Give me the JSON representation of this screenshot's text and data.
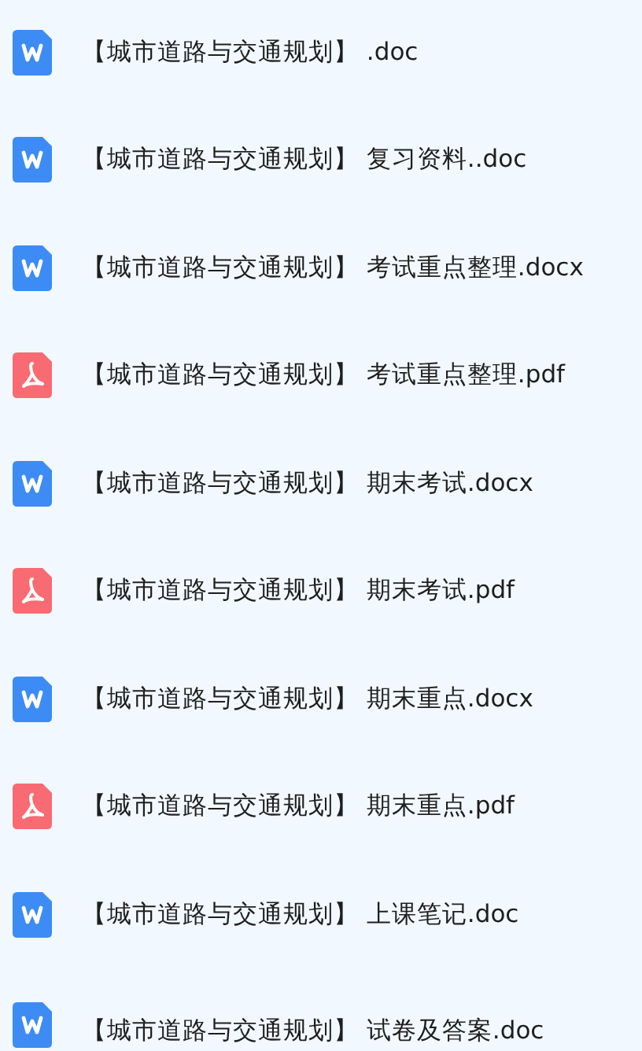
{
  "files": [
    {
      "kind": "doc",
      "name": "【城市道路与交通规划】 .doc"
    },
    {
      "kind": "doc",
      "name": "【城市道路与交通规划】 复习资料..doc"
    },
    {
      "kind": "doc",
      "name": "【城市道路与交通规划】 考试重点整理.docx"
    },
    {
      "kind": "pdf",
      "name": "【城市道路与交通规划】 考试重点整理.pdf"
    },
    {
      "kind": "doc",
      "name": "【城市道路与交通规划】 期末考试.docx"
    },
    {
      "kind": "pdf",
      "name": "【城市道路与交通规划】 期末考试.pdf"
    },
    {
      "kind": "doc",
      "name": "【城市道路与交通规划】 期末重点.docx"
    },
    {
      "kind": "pdf",
      "name": "【城市道路与交通规划】 期末重点.pdf"
    },
    {
      "kind": "doc",
      "name": "【城市道路与交通规划】 上课笔记.doc"
    },
    {
      "kind": "doc",
      "name": "【城市道路与交通规划】 试卷及答案.doc"
    }
  ]
}
